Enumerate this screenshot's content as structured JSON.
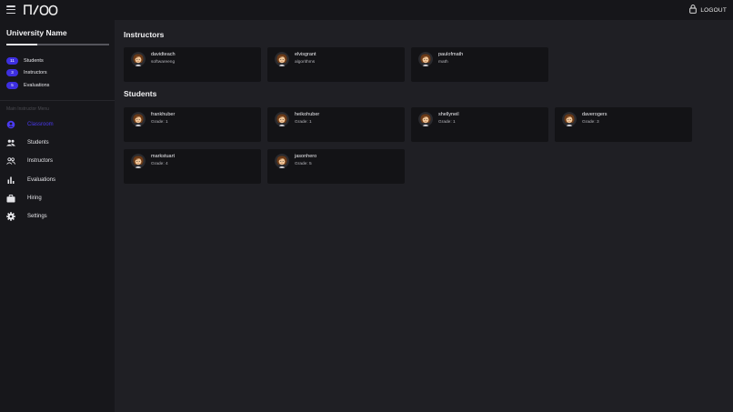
{
  "header": {
    "logo_text": "N/OO",
    "logout_label": "LOGOUT"
  },
  "sidebar": {
    "university_name": "University Name",
    "progress_fraction": 0.3,
    "stats": [
      {
        "count": "11",
        "label": "Students"
      },
      {
        "count": "3",
        "label": "Instructors"
      },
      {
        "count": "5",
        "label": "Evaluations"
      }
    ],
    "menu_heading": "Main Instructor Menu",
    "nav": [
      {
        "label": "Classroom",
        "icon": "classroom-icon",
        "active": true
      },
      {
        "label": "Students",
        "icon": "students-icon"
      },
      {
        "label": "Instructors",
        "icon": "instructors-icon"
      },
      {
        "label": "Evaluations",
        "icon": "bar-chart-icon"
      },
      {
        "label": "Hiring",
        "icon": "briefcase-icon"
      },
      {
        "label": "Settings",
        "icon": "gear-icon"
      }
    ]
  },
  "main": {
    "instructors_title": "Instructors",
    "instructors": [
      {
        "name": "davidteach",
        "subject": "softwareeng"
      },
      {
        "name": "elvisgrant",
        "subject": "algorithms"
      },
      {
        "name": "paulofmath",
        "subject": "math"
      }
    ],
    "students_title": "Students",
    "students": [
      {
        "name": "frankhuber",
        "grade": "Grade: 1"
      },
      {
        "name": "heikohuber",
        "grade": "Grade: 1"
      },
      {
        "name": "shellyneil",
        "grade": "Grade: 1"
      },
      {
        "name": "daverogers",
        "grade": "Grade: 3"
      },
      {
        "name": "markstuart",
        "grade": "Grade: 4"
      },
      {
        "name": "jasonhero",
        "grade": "Grade: 5"
      }
    ]
  },
  "colors": {
    "accent": "#3d2fe0",
    "active_nav": "#4a3af0",
    "background": "#1f1f24",
    "sidebar": "#17171b",
    "card": "#131316"
  }
}
